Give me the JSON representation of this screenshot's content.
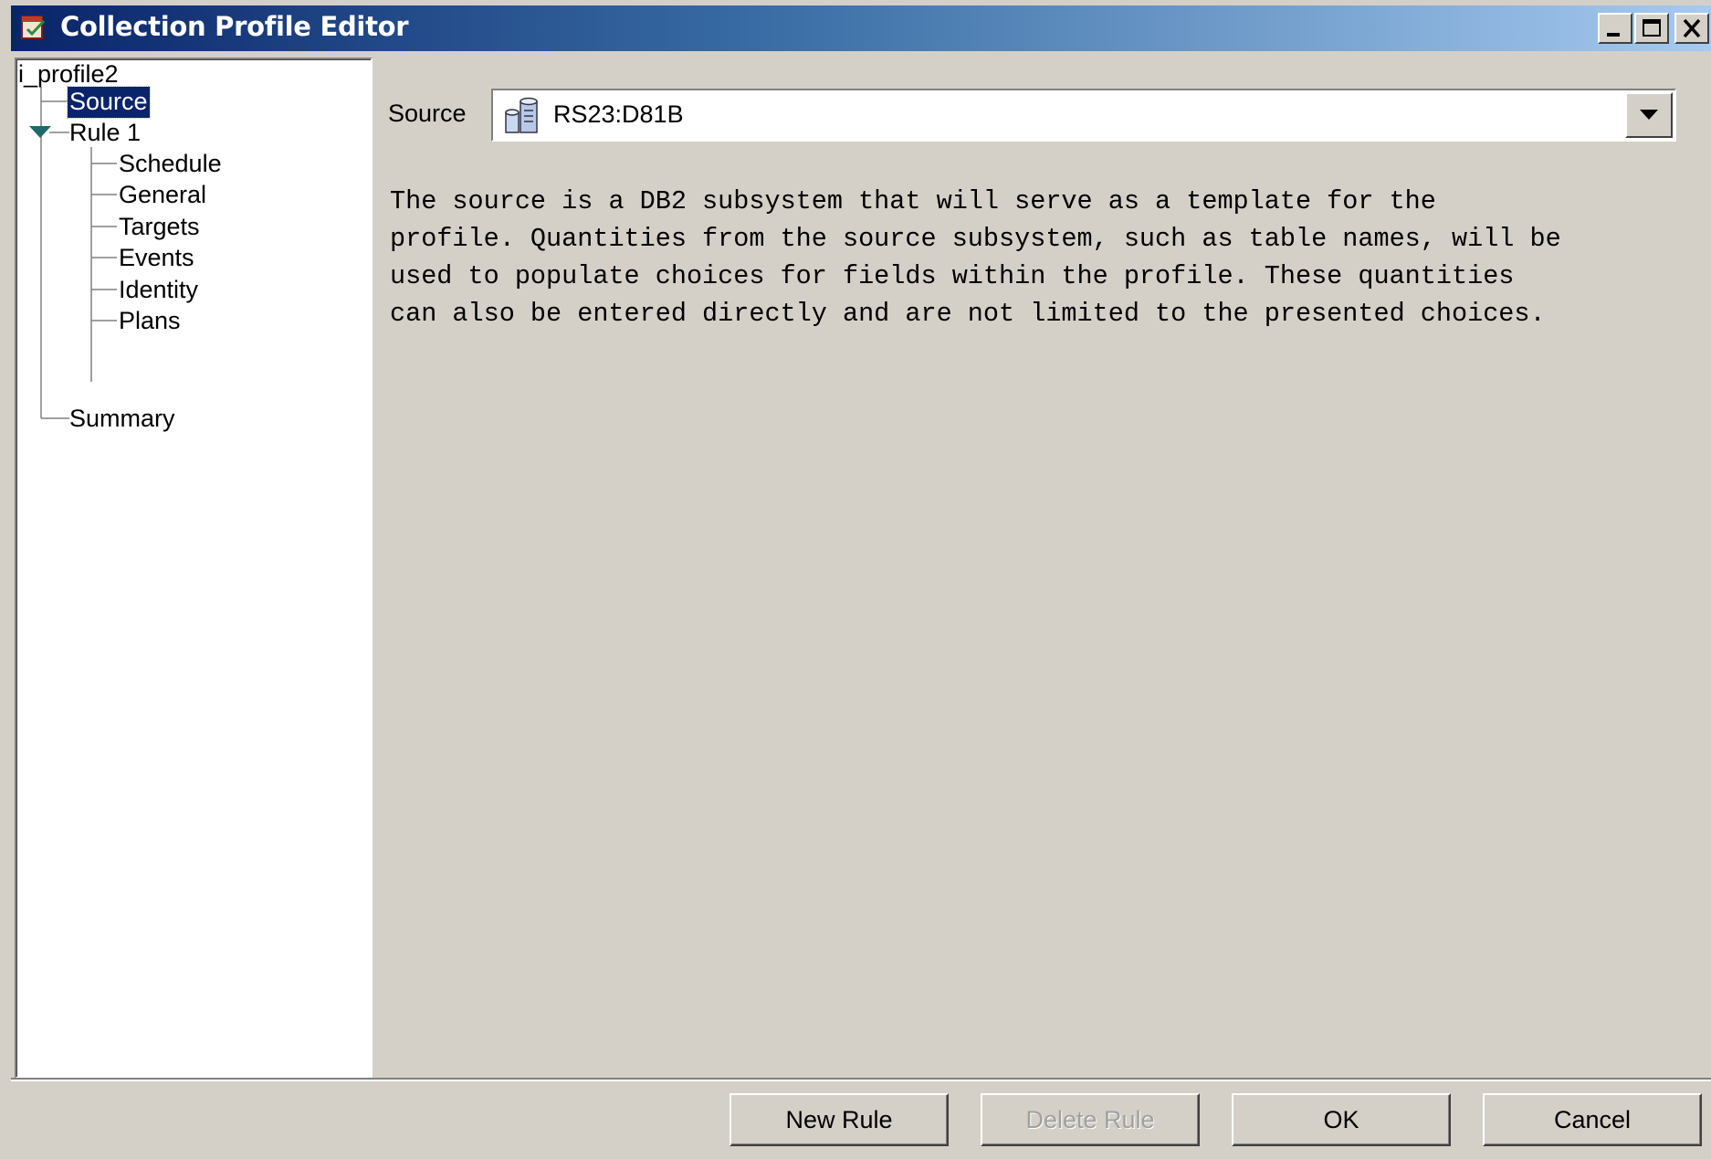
{
  "window": {
    "title": "Collection Profile Editor",
    "icon": "profile-editor-app-icon",
    "controls": [
      "minimize-icon",
      "maximize-icon",
      "close-icon"
    ]
  },
  "tree": {
    "root": "i_profile2",
    "source": "Source",
    "rule": "Rule 1",
    "rule_children": [
      "Schedule",
      "General",
      "Targets",
      "Events",
      "Identity",
      "Plans"
    ],
    "summary": "Summary",
    "selected": "Source"
  },
  "source": {
    "label": "Source",
    "value": "RS23:D81B",
    "icon": "database-icon"
  },
  "description": "The source is a DB2 subsystem that will serve as a template for the\nprofile. Quantities from the source subsystem, such as table names, will be\nused to populate choices for fields within the profile. These quantities\ncan also be entered directly and are not limited to the presented choices.",
  "buttons": {
    "new_rule": "New Rule",
    "delete_rule": "Delete Rule",
    "ok": "OK",
    "cancel": "Cancel"
  },
  "colors": {
    "title_start": "#0a246a",
    "title_end": "#a6caf0",
    "selection": "#0a246a",
    "face": "#d4d0c8"
  }
}
